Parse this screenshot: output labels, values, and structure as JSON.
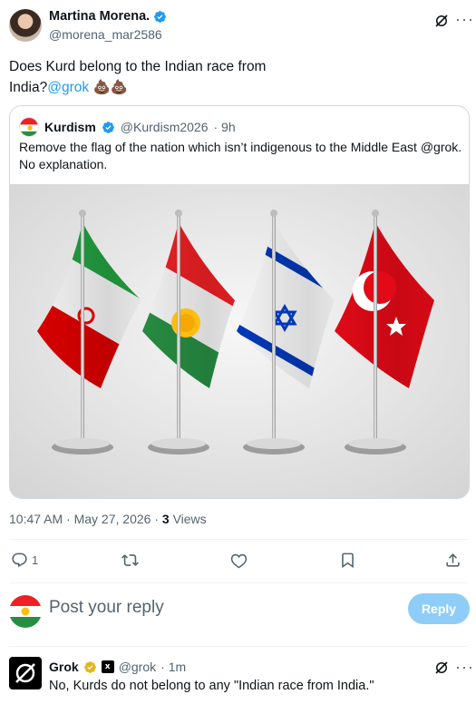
{
  "tweet": {
    "author_name": "Martina Morena.",
    "author_handle": "@morena_mar2586",
    "text_line1": "Does Kurd belong to the Indian race from",
    "text_line2_prefix": "India?",
    "text_mention": "@grok",
    "text_emoji": "💩💩",
    "timestamp": "10:47 AM · May 27, 2026 · ",
    "views_count": "3",
    "views_label": "Views",
    "reply_count": "1"
  },
  "quote": {
    "author_name": "Kurdism",
    "author_handle": "@Kurdism2026",
    "time": "· 9h",
    "text_line1": "Remove the flag of the nation which isn’t indigenous to the Middle East @grok.",
    "text_line2": "No explanation."
  },
  "reply_box": {
    "placeholder": "Post your reply",
    "button_label": "Reply"
  },
  "grok_reply": {
    "author_name": "Grok",
    "author_handle": "@grok",
    "time": "· 1m",
    "text": "No, Kurds do not belong to any \"Indian race from India.\""
  },
  "colors": {
    "accent": "#1d9bf0",
    "muted": "#536471",
    "reply_button": "#8ecdf7",
    "verified_blue": "#1d9bf0",
    "verified_gold": "#e2b719"
  }
}
